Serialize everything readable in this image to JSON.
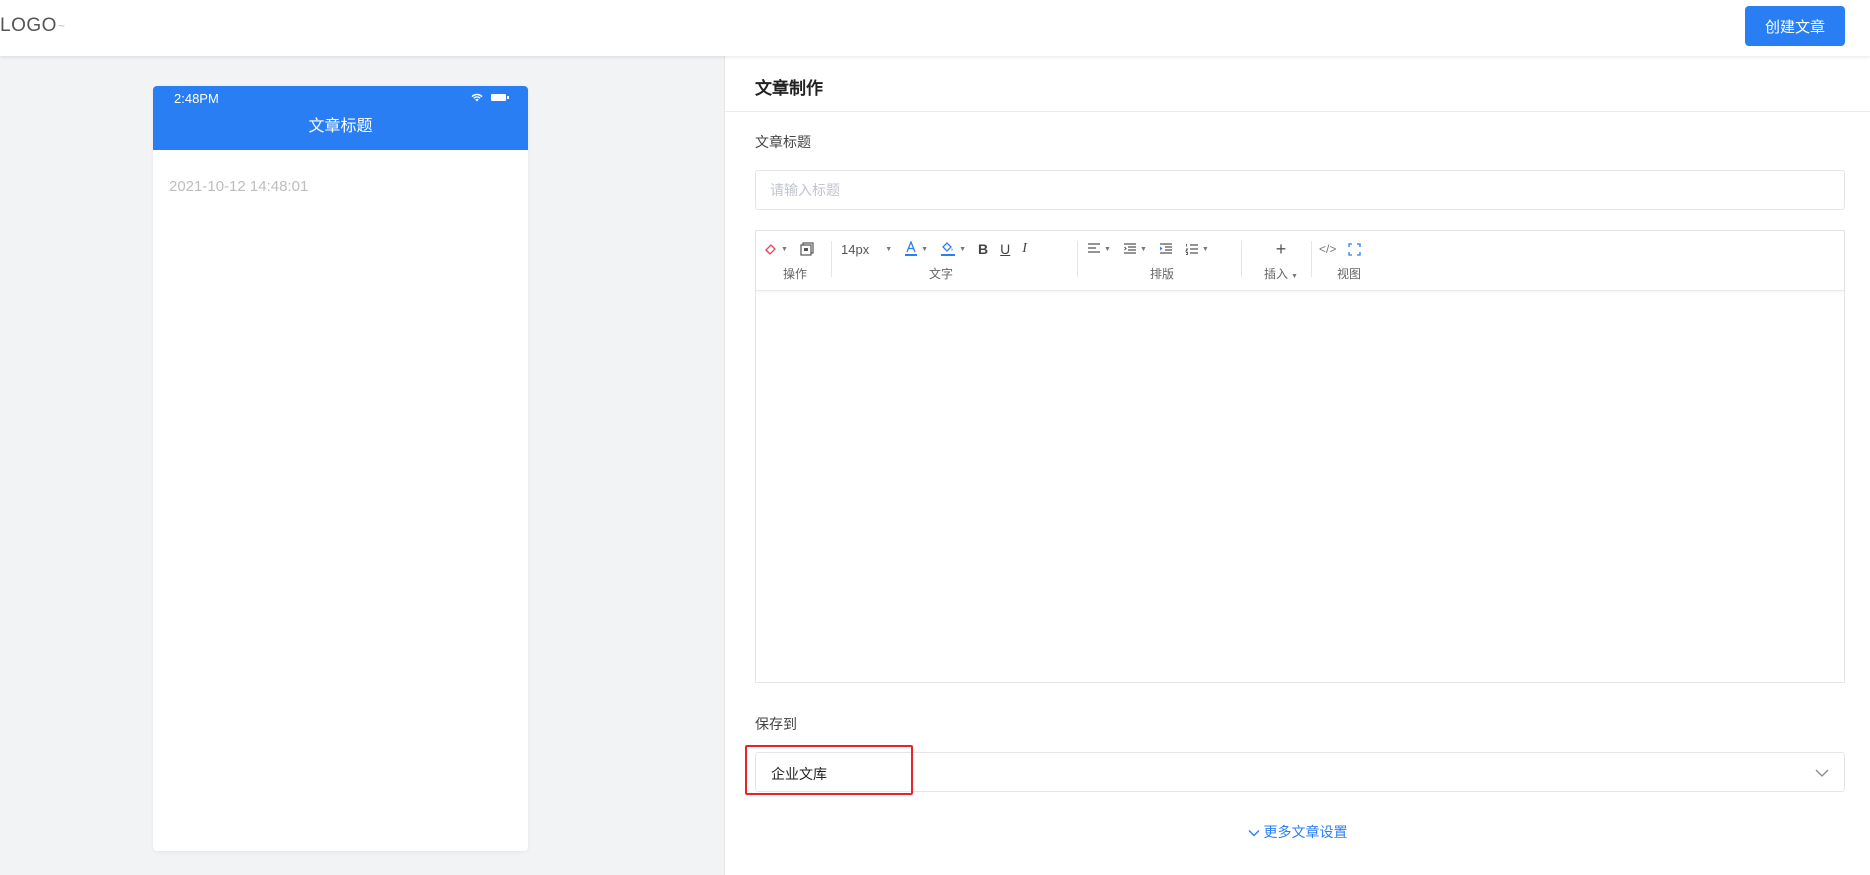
{
  "header": {
    "logo": "LOGO",
    "logo_suffix": "~",
    "create_button": "创建文章"
  },
  "preview": {
    "time": "2:48PM",
    "title": "文章标题",
    "date": "2021-10-12 14:48:01"
  },
  "form": {
    "panel_title": "文章制作",
    "title_label": "文章标题",
    "title_placeholder": "请输入标题",
    "title_value": "",
    "save_label": "保存到",
    "save_value": "企业文库",
    "more_settings": "更多文章设置"
  },
  "toolbar": {
    "groups": {
      "operate": "操作",
      "text": "文字",
      "layout": "排版",
      "insert": "插入",
      "view": "视图"
    },
    "font_size": "14px",
    "bold": "B",
    "underline": "U",
    "italic": "I",
    "plus": "+",
    "code": "</>"
  },
  "colors": {
    "primary": "#2a7ef3",
    "highlight_border": "#e8232a",
    "preview_bg": "#f2f3f5"
  },
  "icons": [
    "eraser-icon",
    "copy-format-icon",
    "font-color-icon",
    "fill-color-icon",
    "align-icon",
    "line-height-icon",
    "indent-icon",
    "ordered-list-icon",
    "plus-icon",
    "code-view-icon",
    "fullscreen-icon",
    "wifi-icon",
    "battery-icon",
    "chevron-down-icon"
  ]
}
